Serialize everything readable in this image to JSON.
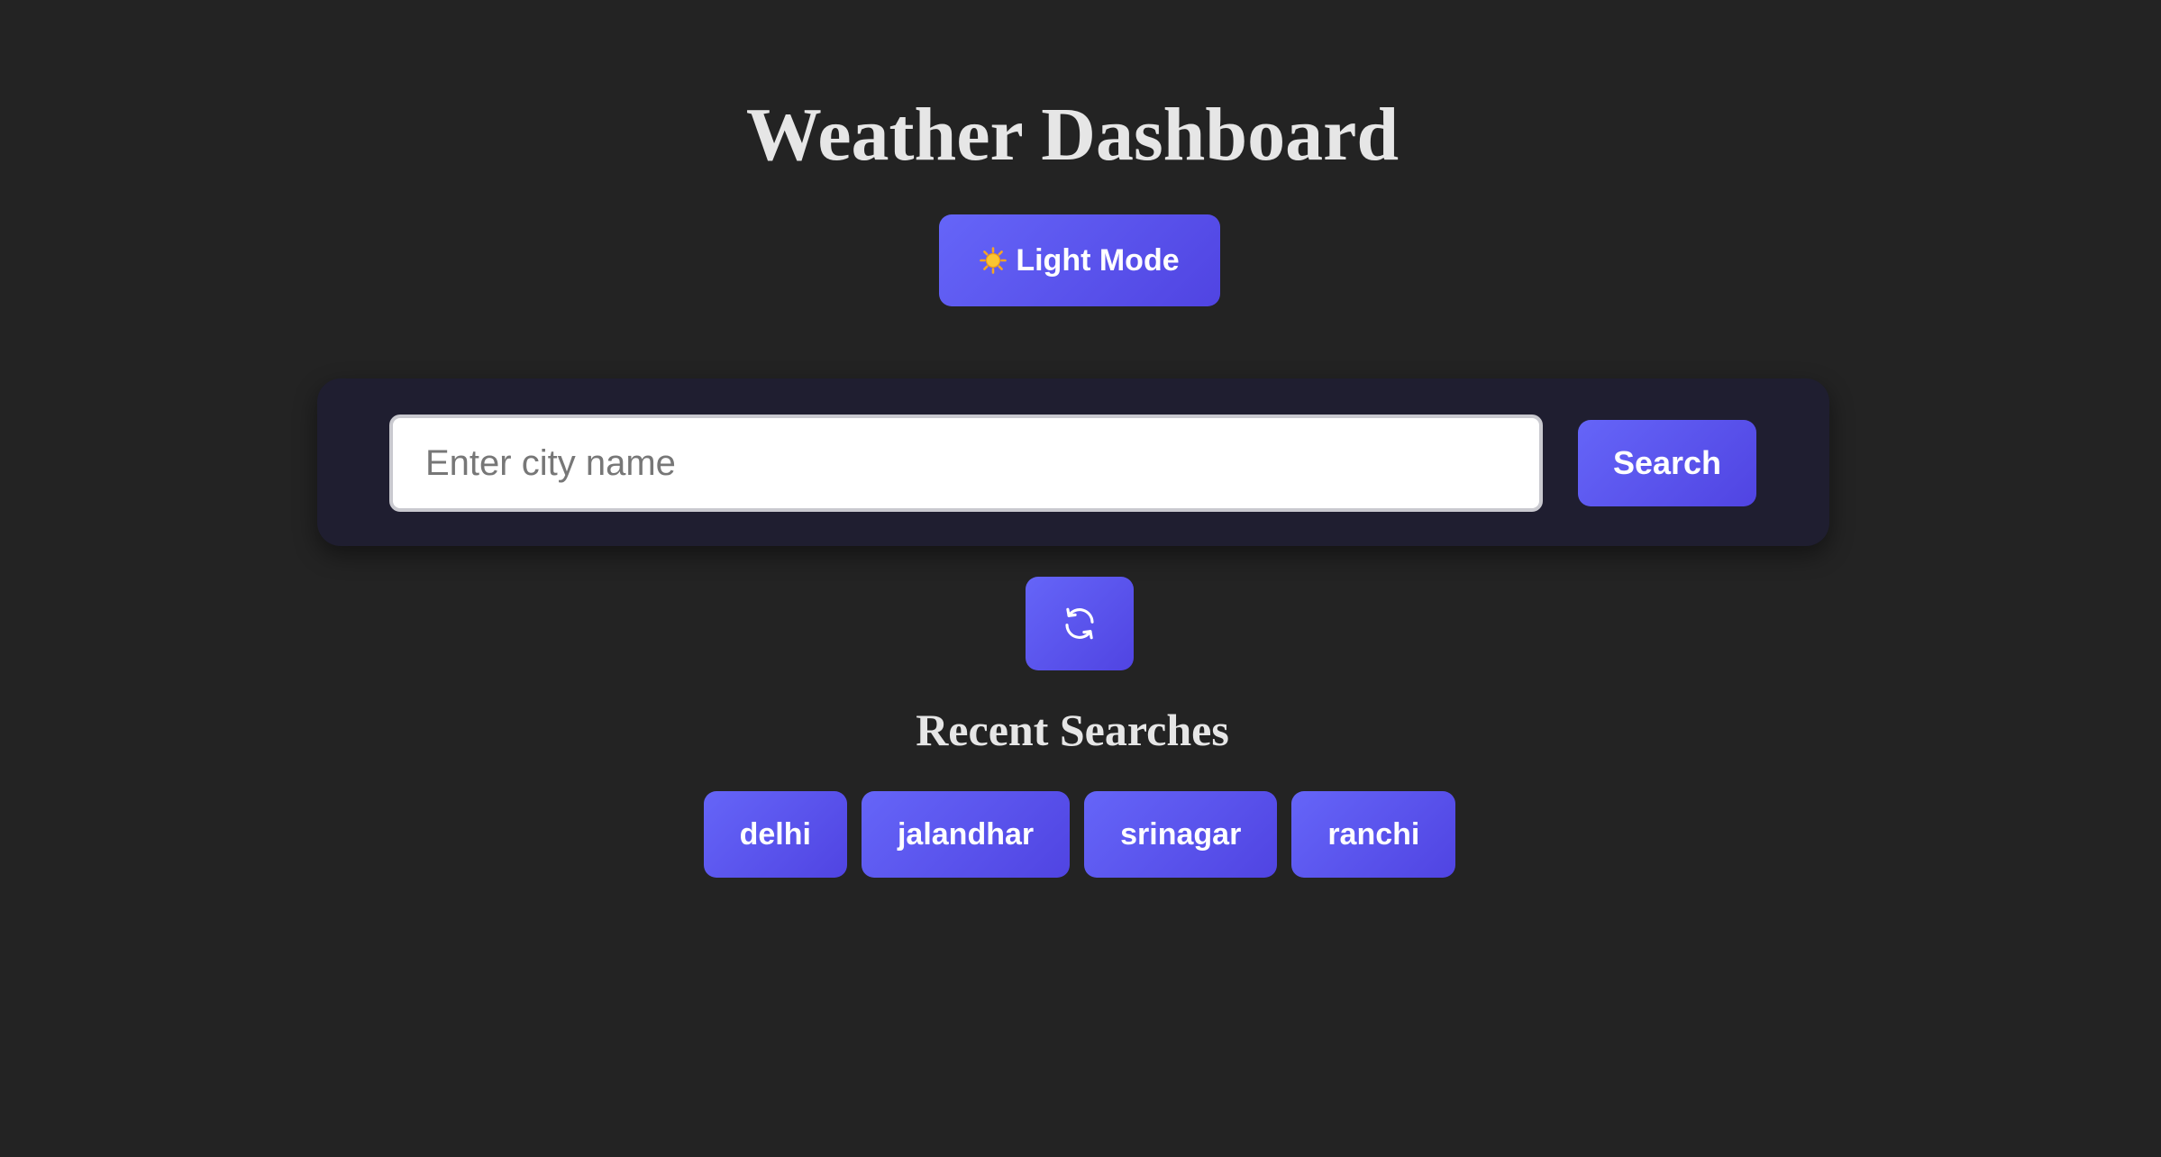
{
  "header": {
    "title": "Weather Dashboard",
    "theme_toggle_label": "Light Mode",
    "theme_toggle_icon": "sun-icon"
  },
  "search": {
    "placeholder": "Enter city name",
    "value": "",
    "button_label": "Search"
  },
  "refresh": {
    "icon": "refresh-icon"
  },
  "recent": {
    "title": "Recent Searches",
    "items": [
      {
        "label": "delhi"
      },
      {
        "label": "jalandhar"
      },
      {
        "label": "srinagar"
      },
      {
        "label": "ranchi"
      }
    ]
  },
  "colors": {
    "background": "#232323",
    "panel": "#1f1e30",
    "accent_start": "#6565f8",
    "accent_end": "#5044e2",
    "heading_text": "#e6e6e6"
  }
}
